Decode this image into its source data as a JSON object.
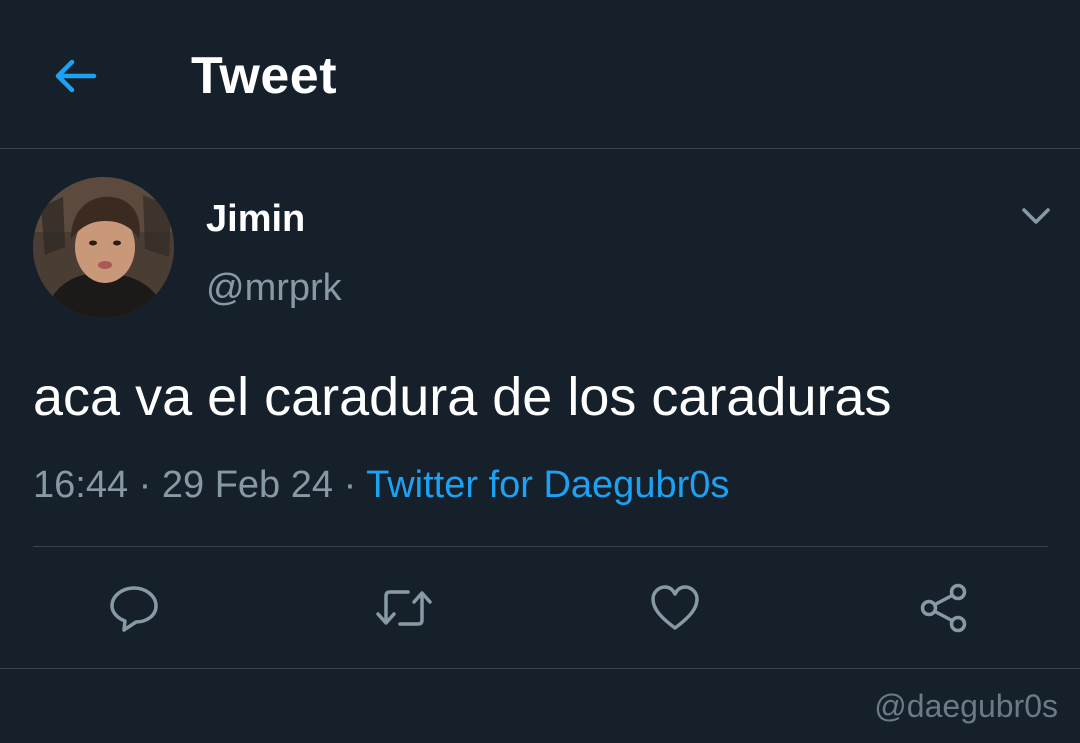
{
  "header": {
    "title": "Tweet",
    "back_icon": "arrow-left-icon"
  },
  "tweet": {
    "author": {
      "display_name": "Jimin",
      "handle": "@mrprk"
    },
    "text": "aca va el caradura de los caraduras",
    "time": "16:44",
    "date": "29 Feb 24",
    "source": "Twitter for Daegubr0s",
    "separator": " · "
  },
  "actions": {
    "reply_icon": "reply-icon",
    "retweet_icon": "retweet-icon",
    "like_icon": "heart-icon",
    "share_icon": "share-icon"
  },
  "watermark": "@daegubr0s",
  "colors": {
    "background": "#15202b",
    "accent": "#1da1f2",
    "secondary_text": "#8899a6",
    "divider": "#38444d"
  }
}
